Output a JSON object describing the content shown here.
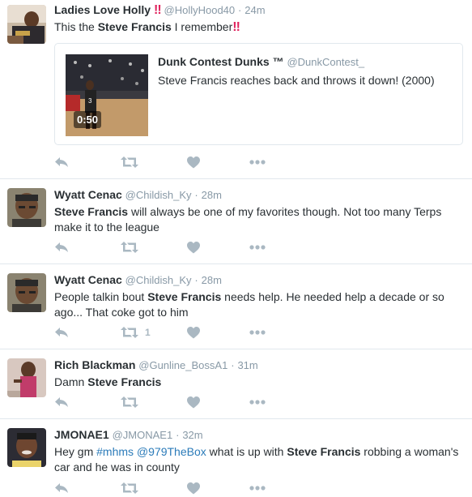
{
  "tweets": [
    {
      "name": "Ladies Love Holly",
      "name_badge": "‼",
      "handle": "@HollyHood40",
      "sep": "·",
      "time": "24m",
      "text_parts": [
        {
          "t": "This the ",
          "style": "plain"
        },
        {
          "t": "Steve Francis",
          "style": "bold"
        },
        {
          "t": " I remember",
          "style": "plain"
        },
        {
          "t": "‼",
          "style": "bang"
        }
      ],
      "card": {
        "name": "Dunk Contest Dunks ™",
        "handle": "@DunkContest_",
        "description": "Steve Francis reaches back and throws it down! (2000)",
        "duration": "0:50"
      },
      "retweets": "",
      "avatar": "avatar-holly"
    },
    {
      "name": "Wyatt Cenac",
      "handle": "@Childish_Ky",
      "sep": "·",
      "time": "28m",
      "text_parts": [
        {
          "t": "Steve Francis",
          "style": "bold"
        },
        {
          "t": " will always be one of my favorites though. Not too many Terps make it to the league",
          "style": "plain"
        }
      ],
      "retweets": "",
      "avatar": "avatar-wyatt"
    },
    {
      "name": "Wyatt Cenac",
      "handle": "@Childish_Ky",
      "sep": "·",
      "time": "28m",
      "text_parts": [
        {
          "t": "People talkin bout ",
          "style": "plain"
        },
        {
          "t": "Steve Francis",
          "style": "bold"
        },
        {
          "t": " needs help. He needed help a decade or so ago... That coke got to him",
          "style": "plain"
        }
      ],
      "retweets": "1",
      "avatar": "avatar-wyatt"
    },
    {
      "name": "Rich Blackman",
      "handle": "@Gunline_BossA1",
      "sep": "·",
      "time": "31m",
      "text_parts": [
        {
          "t": "Damn ",
          "style": "plain"
        },
        {
          "t": "Steve Francis",
          "style": "bold"
        }
      ],
      "retweets": "",
      "avatar": "avatar-rich"
    },
    {
      "name": "JMONAE1",
      "handle": "@JMONAE1",
      "sep": "·",
      "time": "32m",
      "text_parts": [
        {
          "t": "Hey gm ",
          "style": "plain"
        },
        {
          "t": "#mhms",
          "style": "hashtag"
        },
        {
          "t": " ",
          "style": "plain"
        },
        {
          "t": "@979TheBox",
          "style": "mention"
        },
        {
          "t": " what is up with ",
          "style": "plain"
        },
        {
          "t": "Steve Francis",
          "style": "bold"
        },
        {
          "t": " robbing a woman's car and he was in county",
          "style": "plain"
        }
      ],
      "retweets": "",
      "avatar": "avatar-jmonae"
    }
  ],
  "icons": {
    "reply": "reply-icon",
    "retweet": "retweet-icon",
    "like": "heart-icon",
    "more": "more-icon"
  },
  "colors": {
    "icon_gray": "#aab8c2",
    "link_blue": "#2b7bb9",
    "bang_red": "#e0245e",
    "meta_gray": "#8899a6",
    "divider": "#e1e8ed"
  }
}
